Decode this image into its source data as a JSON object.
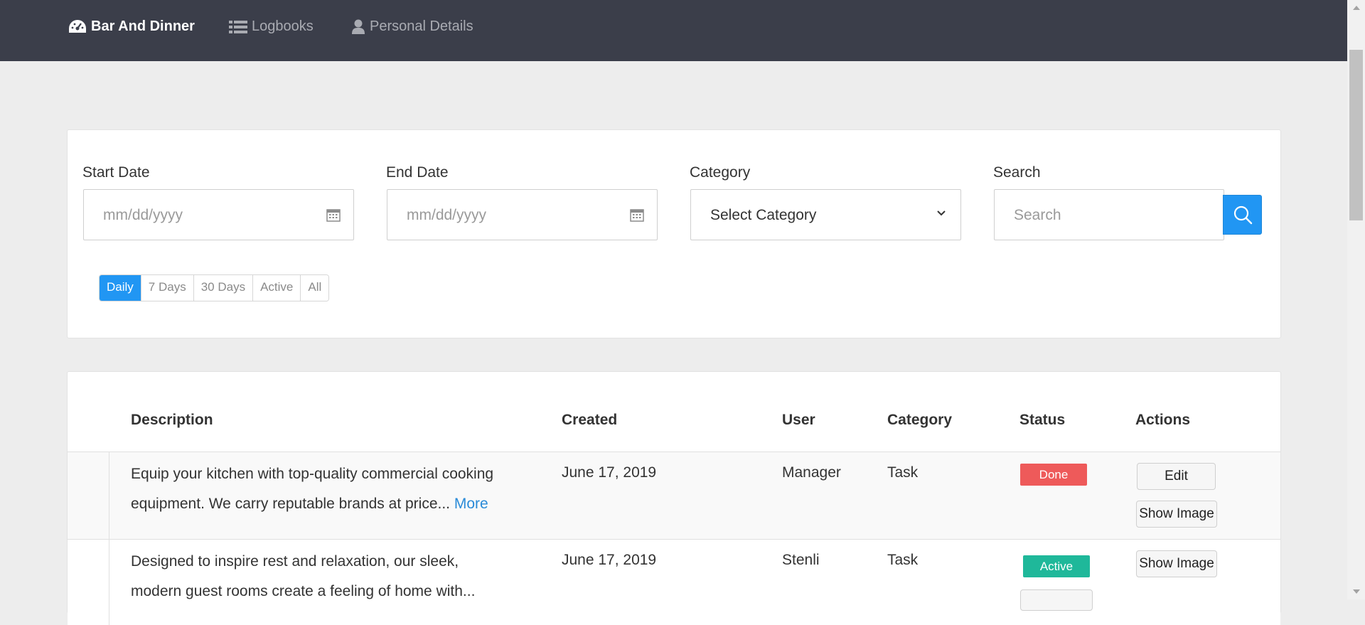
{
  "nav": {
    "brand": "Bar And Dinner",
    "logbooks": "Logbooks",
    "personal_details": "Personal Details"
  },
  "filters": {
    "start_date": {
      "label": "Start Date",
      "placeholder": "mm/dd/yyyy"
    },
    "end_date": {
      "label": "End Date",
      "placeholder": "mm/dd/yyyy"
    },
    "category": {
      "label": "Category",
      "selected": "Select Category"
    },
    "search": {
      "label": "Search",
      "placeholder": "Search"
    },
    "ranges": [
      "Daily",
      "7 Days",
      "30 Days",
      "Active",
      "All"
    ],
    "active_range": "Daily"
  },
  "table": {
    "headers": {
      "description": "Description",
      "created": "Created",
      "user": "User",
      "category": "Category",
      "status": "Status",
      "actions": "Actions"
    },
    "rows": [
      {
        "description": "Equip your kitchen with top-quality commercial cooking equipment. We carry reputable brands at price...",
        "more": "More",
        "created": "June 17, 2019",
        "user": "Manager",
        "category": "Task",
        "status": "Done",
        "actions": [
          "Edit",
          "Show Image"
        ]
      },
      {
        "description": "Designed to inspire rest and relaxation, our sleek, modern guest rooms create a feeling of home with...",
        "created": "June 17, 2019",
        "user": "Stenli",
        "category": "Task",
        "status": "Active",
        "actions": [
          "Show Image"
        ]
      }
    ]
  },
  "colors": {
    "nav_bg": "#3b3e4a",
    "accent": "#2196f3",
    "done": "#ee5a5a",
    "active": "#1fb89a"
  }
}
